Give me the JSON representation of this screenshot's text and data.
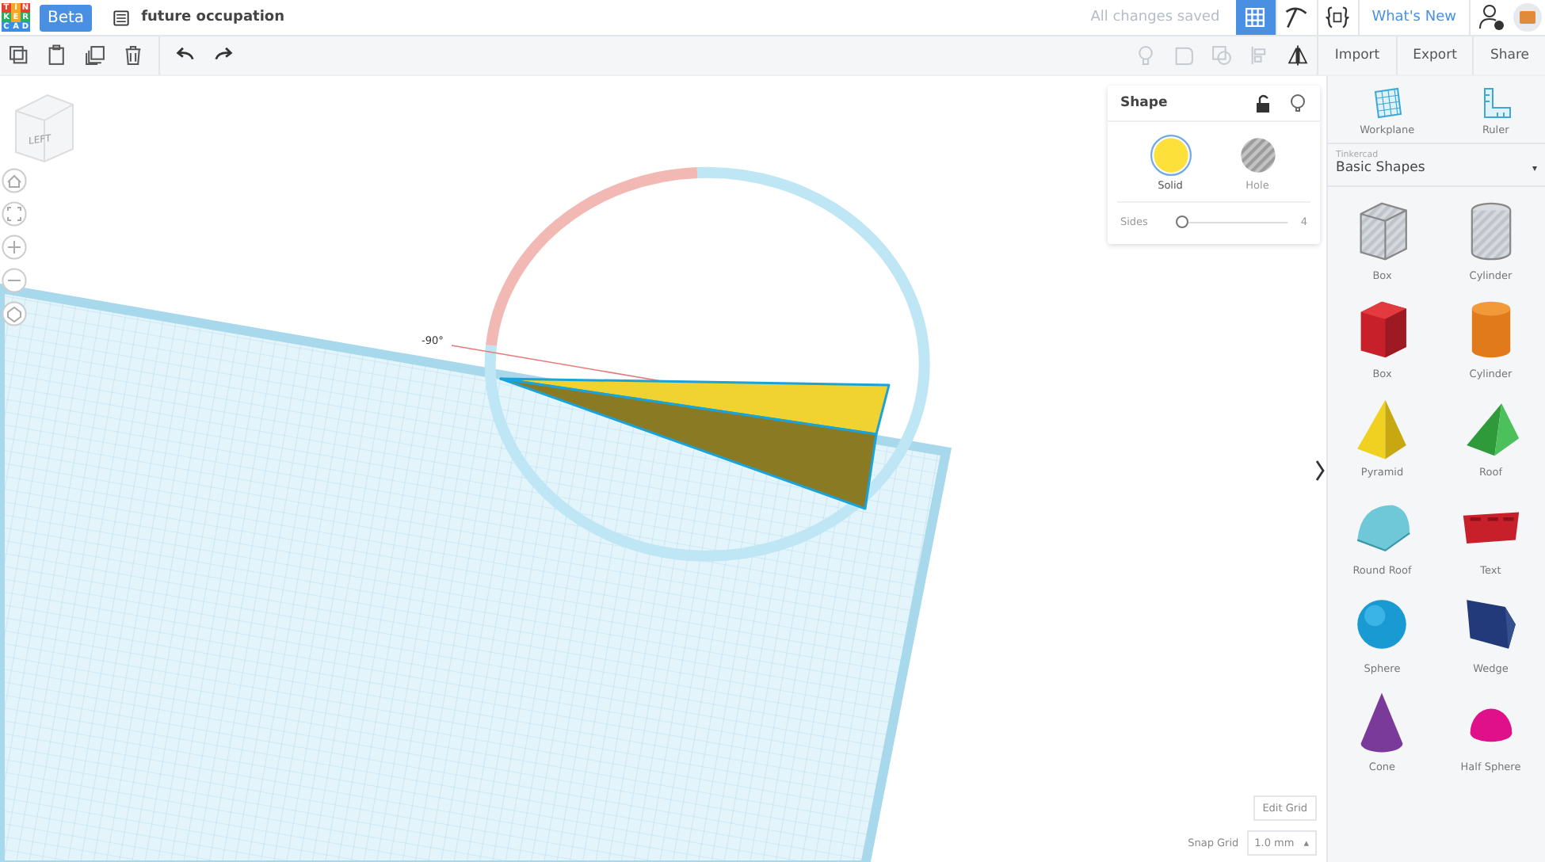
{
  "topbar": {
    "logo_letters": [
      "T",
      "I",
      "N",
      "K",
      "E",
      "R",
      "C",
      "A",
      "D"
    ],
    "badge": "Beta",
    "title": "future occupation",
    "save_status": "All changes saved",
    "whats_new": "What's New"
  },
  "toolbar": {
    "actions": [
      "Import",
      "Export",
      "Share"
    ]
  },
  "viewcube": {
    "face": "LEFT"
  },
  "canvas": {
    "angle_label": "-90°"
  },
  "inspector": {
    "title": "Shape",
    "modes": [
      {
        "label": "Solid",
        "kind": "solid",
        "selected": true
      },
      {
        "label": "Hole",
        "kind": "hole",
        "selected": false
      }
    ],
    "slider": {
      "label": "Sides",
      "level": 0.05,
      "reading": "4"
    }
  },
  "grid_controls": {
    "edit_button": "Edit Grid",
    "snap_label": "Snap Grid",
    "snap_value": "1.0 mm",
    "snap_arrow": "▴"
  },
  "library": {
    "tools": [
      {
        "label": "Workplane",
        "kind": "workplane"
      },
      {
        "label": "Ruler",
        "kind": "ruler"
      }
    ],
    "source": "Tinkercad",
    "category": "Basic Shapes",
    "category_arrow": "▾",
    "shapes": [
      {
        "label": "Box",
        "kind": "box-hole"
      },
      {
        "label": "Cylinder",
        "kind": "cylinder-hole"
      },
      {
        "label": "Box",
        "kind": "box"
      },
      {
        "label": "Cylinder",
        "kind": "cylinder"
      },
      {
        "label": "Pyramid",
        "kind": "pyramid"
      },
      {
        "label": "Roof",
        "kind": "roof"
      },
      {
        "label": "Round Roof",
        "kind": "round-roof"
      },
      {
        "label": "Text",
        "kind": "text"
      },
      {
        "label": "Sphere",
        "kind": "sphere"
      },
      {
        "label": "Wedge",
        "kind": "wedge"
      },
      {
        "label": "Cone",
        "kind": "cone"
      },
      {
        "label": "Half Sphere",
        "kind": "half-sphere"
      }
    ]
  }
}
